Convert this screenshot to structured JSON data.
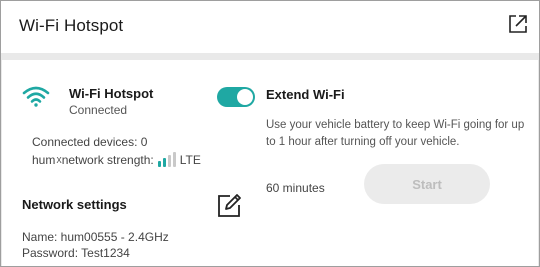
{
  "header": {
    "title": "Wi-Fi Hotspot",
    "icon": "external-link-icon"
  },
  "hotspot": {
    "icon": "wifi-icon",
    "name": "Wi-Fi Hotspot",
    "status": "Connected",
    "connected_devices": "Connected devices: 0",
    "strength_label_main": "hum",
    "strength_label_sup": "X",
    "strength_label_rest": " network strength:",
    "strength_value": "LTE",
    "signal_bars_filled": 2,
    "signal_bars_total": 4
  },
  "network_settings": {
    "title": "Network settings",
    "edit_icon": "edit-icon",
    "name": "Name: hum00555 - 2.4GHz",
    "password": "Password: Test1234"
  },
  "extend": {
    "toggle_on": true,
    "title": "Extend Wi-Fi",
    "description": "Use your vehicle battery to keep Wi-Fi going for up to 1 hour after turning off your vehicle.",
    "duration": "60 minutes",
    "start_label": "Start"
  },
  "colors": {
    "accent": "#1fa8a3",
    "bar_filled": "#1fa8a3",
    "bar_empty": "#c9c9c9",
    "panel_bg": "#ffffff",
    "page_bg": "#e9e9e9"
  }
}
